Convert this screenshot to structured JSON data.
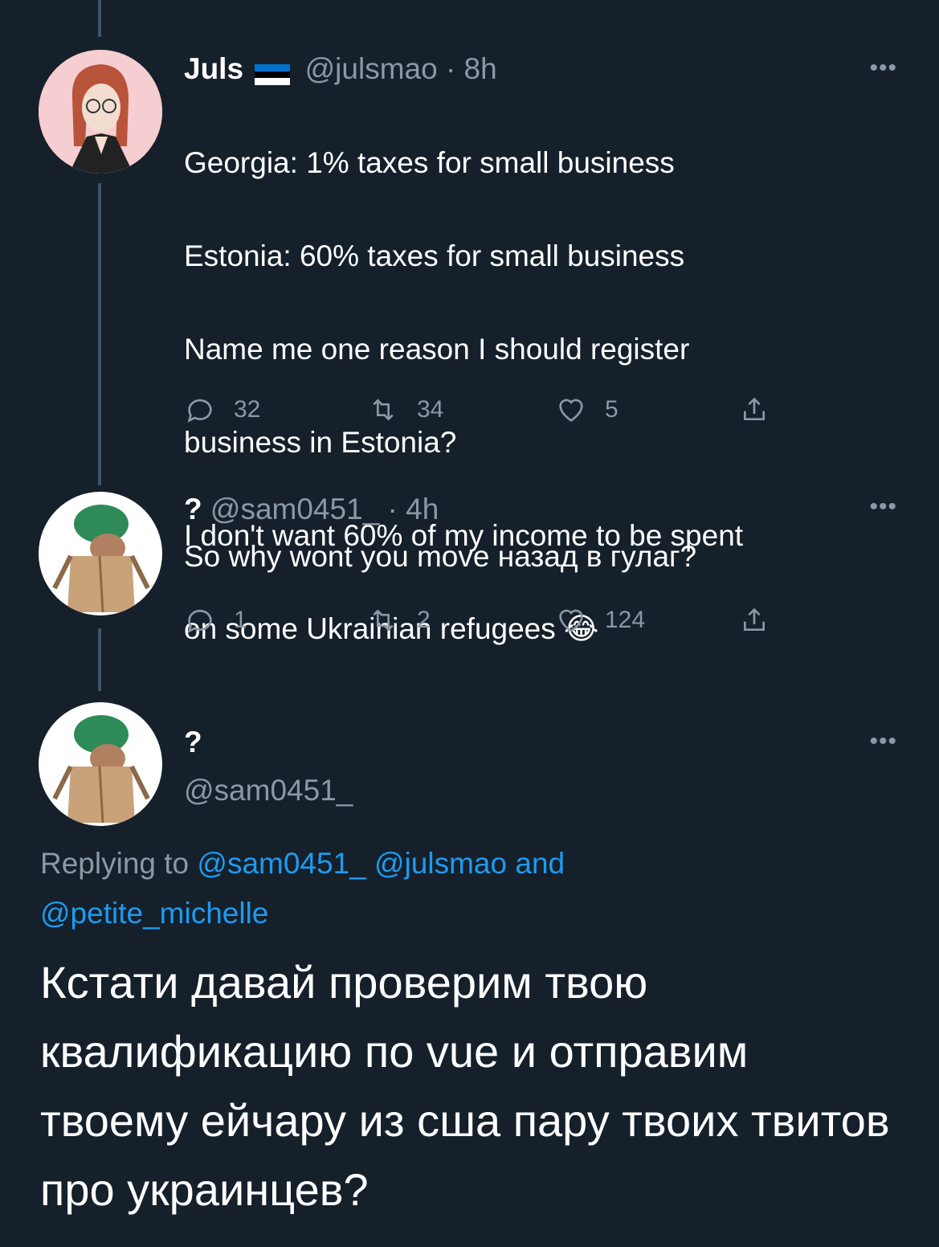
{
  "tweet1": {
    "name": "Juls",
    "handle": "@julsmao",
    "time": "· 8h",
    "lines": [
      "Georgia: 1% taxes for small business",
      "Estonia: 60% taxes for small business",
      "Name me one reason I should register",
      "business in Estonia?",
      "I don't want 60% of my income to be spent",
      "on some Ukrainian refugees 😂"
    ],
    "replies": "32",
    "retweets": "34",
    "likes": "5"
  },
  "tweet2": {
    "name": "?",
    "handle": "@sam0451_",
    "time": "· 4h",
    "text": "So why wont you move назад в гулаг?",
    "replies": "1",
    "retweets": "2",
    "likes": "124"
  },
  "tweet3": {
    "name": "?",
    "handle": "@sam0451_",
    "replying_prefix": "Replying to",
    "mention1": "@sam0451_",
    "mention2": "@julsmao",
    "and_text": "and",
    "mention3": "@petite_michelle",
    "text": "Кстати давай проверим твою квалификацию по vue и отправим твоему ейчару из сша пару твоих твитов про украинцев?"
  },
  "icons": {
    "more": "more-horizontal-icon",
    "reply": "reply-icon",
    "retweet": "retweet-icon",
    "like": "heart-icon",
    "share": "share-icon",
    "flag": "estonia-flag-icon"
  },
  "colors": {
    "background": "#15202b",
    "muted": "#8b98a5",
    "link": "#1d9bf0",
    "thread_line": "#3d5466"
  }
}
